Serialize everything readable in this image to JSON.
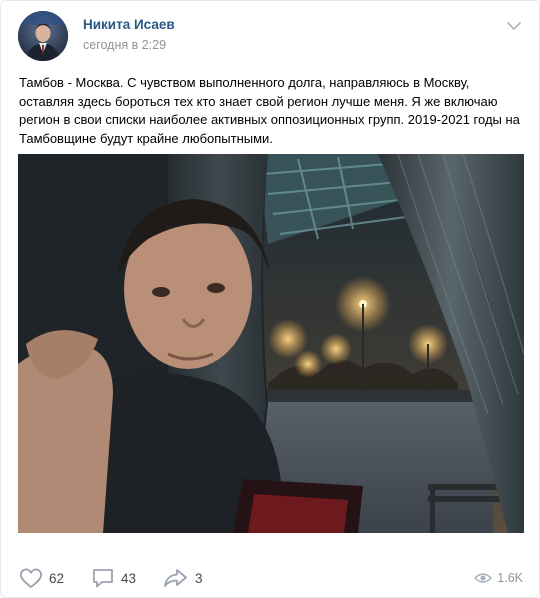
{
  "post": {
    "author": "Никита Исаев",
    "time": "сегодня в 2:29",
    "text": "Тамбов - Москва. С чувством выполненного долга, направляюсь в Москву, оставляя здесь бороться тех кто знает свой регион лучше меня. Я же включаю регион в свои списки наиболее активных оппозиционных групп. 2019-2021 годы на Тамбовщине будут крайне любопытными."
  },
  "actions": {
    "likes": "62",
    "comments": "43",
    "shares": "3",
    "views": "1.6K"
  },
  "icons": {
    "menu": "chevron-down-icon",
    "like": "heart-icon",
    "comment": "comment-icon",
    "share": "share-arrow-icon",
    "views": "eye-icon"
  },
  "colors": {
    "author_link": "#2a5885",
    "muted": "#939393",
    "icon": "#99a2ad"
  }
}
